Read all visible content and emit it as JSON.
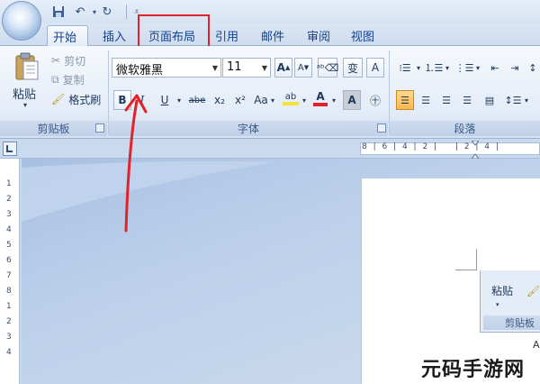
{
  "window": {
    "tabs": [
      {
        "id": "home",
        "label": "开始"
      },
      {
        "id": "insert",
        "label": "插入"
      },
      {
        "id": "page_layout",
        "label": "页面布局"
      },
      {
        "id": "references",
        "label": "引用"
      },
      {
        "id": "mailings",
        "label": "邮件"
      },
      {
        "id": "review",
        "label": "审阅"
      },
      {
        "id": "view",
        "label": "视图"
      }
    ],
    "active_tab": "开始"
  },
  "clipboard": {
    "paste_label": "粘贴",
    "cut_label": "剪切",
    "copy_label": "复制",
    "format_painter_label": "格式刷",
    "group_label": "剪贴板"
  },
  "font": {
    "font_name": "微软雅黑",
    "font_size": "11",
    "grow_label": "A",
    "shrink_label": "A",
    "change_case_label": "Aa",
    "bold_label": "B",
    "italic_label": "I",
    "underline_label": "U",
    "strike_label": "abe",
    "subscript_label": "x₂",
    "superscript_label": "x²",
    "highlight_label": "ab",
    "color_label": "A",
    "phonetic_label": "变",
    "border_label": "A",
    "group_label": "字体"
  },
  "paragraph": {
    "group_label": "段落"
  },
  "ruler": {
    "horizontal_ticks": "8 | 6 | 4 | 2 |",
    "horizontal_ticks_right": "| 2 | 4 |",
    "vertical_numbers": [
      "1",
      "2",
      "3",
      "4",
      "5",
      "6",
      "7",
      "8",
      "1",
      "2",
      "3",
      "4"
    ]
  },
  "snippet": {
    "paste_label": "粘贴",
    "group_label": "剪贴板",
    "bottom_label": "A"
  },
  "watermark": "元码手游网",
  "colors": {
    "accent_red": "#e0222a",
    "font_color_bar": "#e0222a",
    "highlight_bar": "#f4e23c",
    "active_align": "#ffb84a"
  }
}
